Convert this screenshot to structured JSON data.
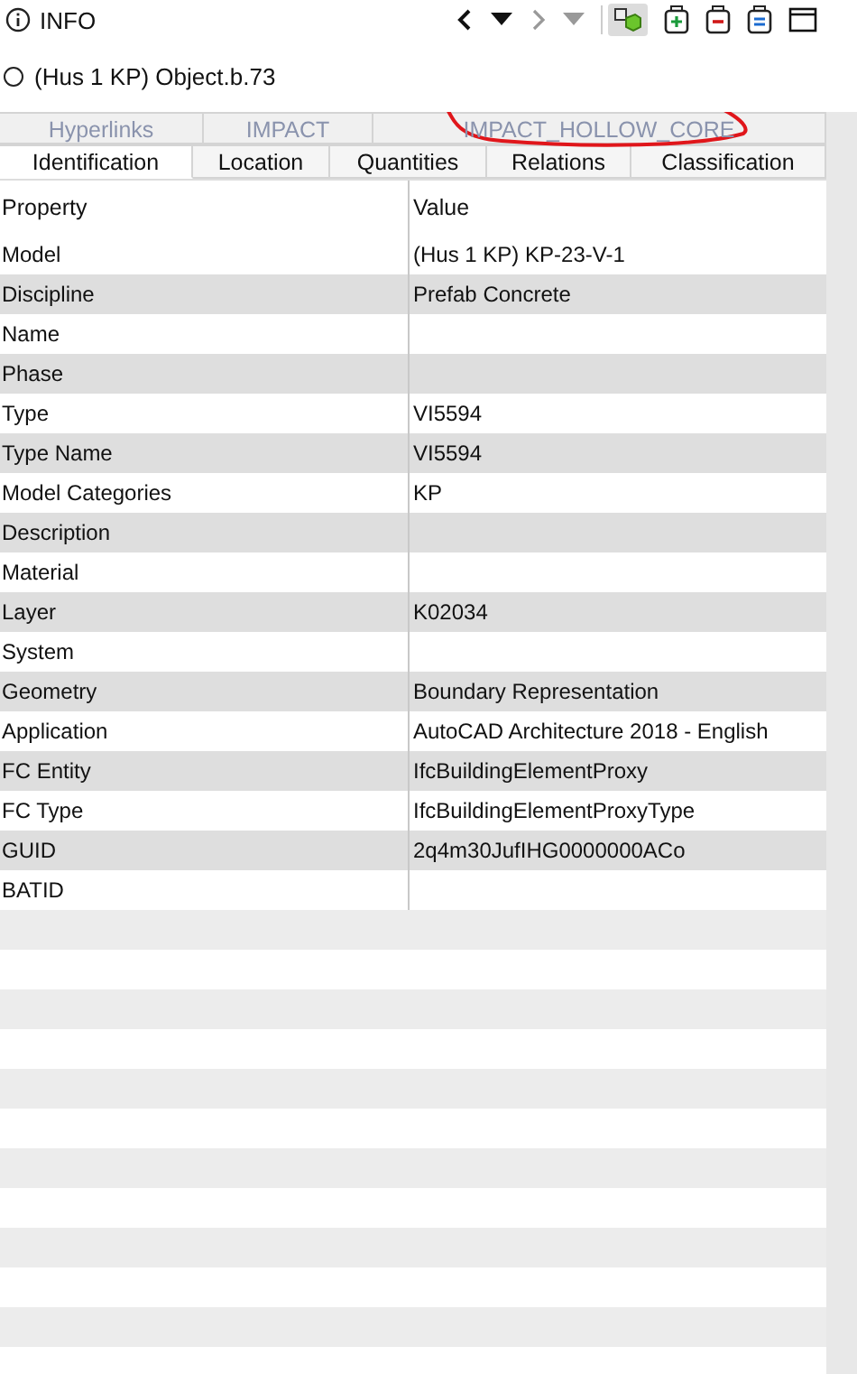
{
  "panel": {
    "title": "INFO"
  },
  "object": {
    "label": "(Hus 1 KP) Object.b.73",
    "selected": false
  },
  "tab_rows": [
    {
      "tabs": [
        {
          "label": "Hyperlinks",
          "selected": false
        },
        {
          "label": "IMPACT",
          "selected": false
        },
        {
          "label": "IMPACT_HOLLOW_CORE",
          "selected": false
        }
      ]
    },
    {
      "tabs": [
        {
          "label": "Identification",
          "selected": true
        },
        {
          "label": "Location",
          "selected": false
        },
        {
          "label": "Quantities",
          "selected": false
        },
        {
          "label": "Relations",
          "selected": false
        },
        {
          "label": "Classification",
          "selected": false
        }
      ]
    }
  ],
  "table": {
    "columns": [
      "Property",
      "Value"
    ],
    "rows": [
      {
        "property": "Model",
        "value": "(Hus 1 KP) KP-23-V-1"
      },
      {
        "property": "Discipline",
        "value": "Prefab Concrete"
      },
      {
        "property": "Name",
        "value": ""
      },
      {
        "property": "Phase",
        "value": ""
      },
      {
        "property": "Type",
        "value": "VI5594"
      },
      {
        "property": "Type Name",
        "value": "VI5594"
      },
      {
        "property": "Model Categories",
        "value": "KP"
      },
      {
        "property": "Description",
        "value": ""
      },
      {
        "property": "Material",
        "value": ""
      },
      {
        "property": "Layer",
        "value": "K02034"
      },
      {
        "property": "System",
        "value": ""
      },
      {
        "property": "Geometry",
        "value": "Boundary Representation"
      },
      {
        "property": "Application",
        "value": "AutoCAD Architecture 2018 - English"
      },
      {
        "property": "FC Entity",
        "value": "IfcBuildingElementProxy"
      },
      {
        "property": "FC Type",
        "value": "IfcBuildingElementProxyType"
      },
      {
        "property": "GUID",
        "value": "2q4m30JufIHG0000000ACo"
      },
      {
        "property": "BATID",
        "value": ""
      }
    ]
  }
}
